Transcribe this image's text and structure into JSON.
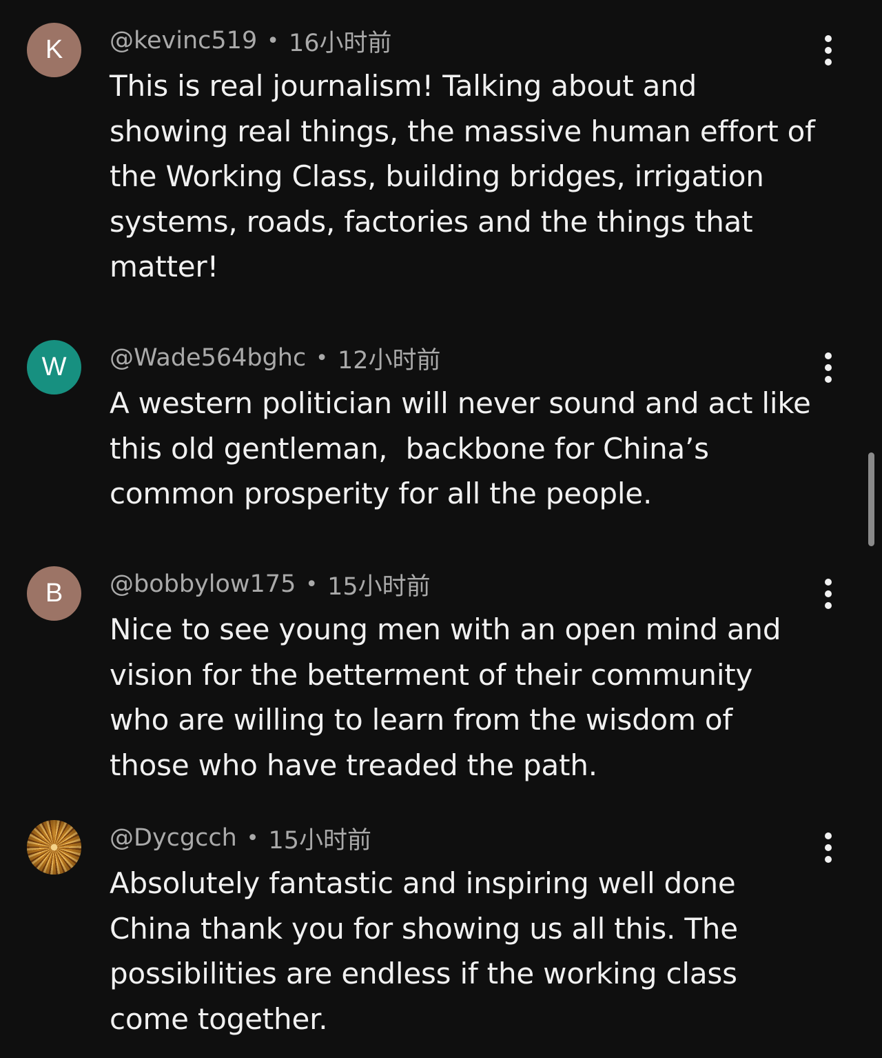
{
  "colors": {
    "background": "#0f0f0f",
    "text": "#f1f1f1",
    "meta_text": "#aaaaaa"
  },
  "comments": [
    {
      "avatar": {
        "letter": "K",
        "color": "#9c7466"
      },
      "handle": "@kevinc519",
      "time": "16小时前",
      "lines": [
        "This is real journalism! Talking about and",
        "showing real things, the massive human effort of",
        "the Working Class, building bridges, irrigation",
        "systems, roads, factories and the things that",
        "matter!"
      ],
      "menu_icon": "more-vertical-icon"
    },
    {
      "avatar": {
        "letter": "W",
        "color": "#179080"
      },
      "handle": "@Wade564bghc",
      "time": "12小时前",
      "lines": [
        "A western politician will never sound and act like",
        "this old gentleman,  backbone for China’s",
        "common prosperity for all the people."
      ],
      "menu_icon": "more-vertical-icon"
    },
    {
      "avatar": {
        "letter": "B",
        "color": "#9c7466"
      },
      "handle": "@bobbylow175",
      "time": "15小时前",
      "lines": [
        "Nice to see young men with an open mind and",
        "vision for the betterment of their community",
        "who are willing to learn from the wisdom of",
        "those who have treaded the path."
      ],
      "menu_icon": "more-vertical-icon"
    },
    {
      "avatar": {
        "letter": "",
        "color": "#a86a22"
      },
      "handle": "@Dycgcch",
      "time": "15小时前",
      "lines": [
        "Absolutely fantastic and inspiring well done",
        "China thank you for showing us all this. The",
        "possibilities are endless if the working class",
        "come together."
      ],
      "menu_icon": "more-vertical-icon"
    }
  ],
  "separator": "•"
}
